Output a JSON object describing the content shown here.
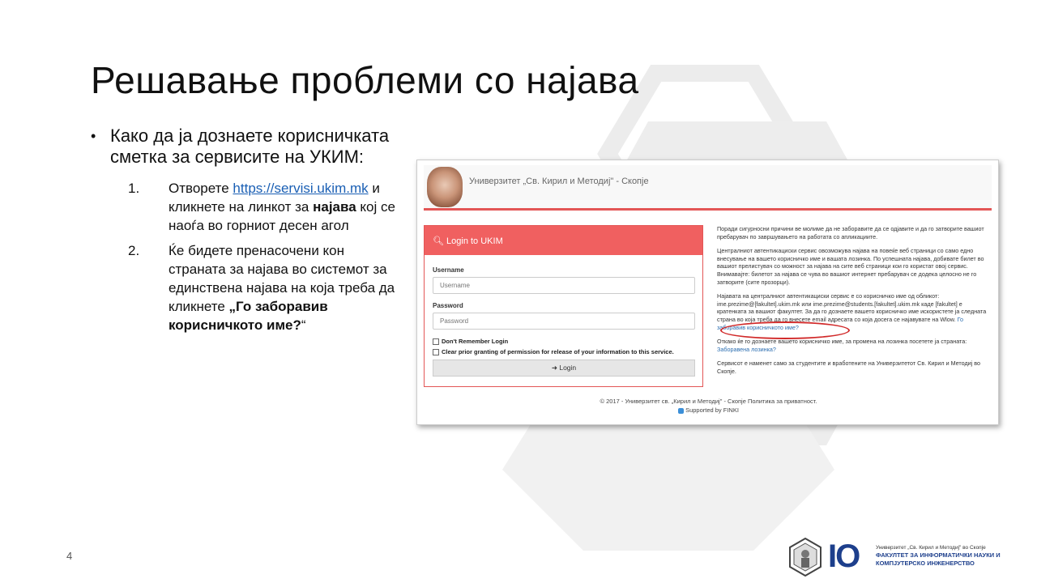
{
  "slide": {
    "title": "Решавање проблеми со најава",
    "page_number": "4"
  },
  "bullets": {
    "main": "Како да ја дознаете корисничката сметка за сервисите на УКИМ:",
    "steps": [
      {
        "num": "1.",
        "before": "Отворете ",
        "link": "https://servisi.ukim.mk",
        "middle": " и кликнете на линкот за ",
        "bold": "најава",
        "after": " кој се наоѓа во горниот десен агол"
      },
      {
        "num": "2.",
        "before": "Ќе бидете пренасочени кон страната за најава во системот за единствена најава на која треба да кликнете ",
        "bold": "„Го заборавив корисничкото име?",
        "after": "“"
      }
    ]
  },
  "screenshot": {
    "university": "Универзитет „Св. Кирил и Методиј\" - Скопје",
    "login": {
      "header": "Login to UKIM",
      "username_label": "Username",
      "username_placeholder": "Username",
      "password_label": "Password",
      "password_placeholder": "Password",
      "remember": "Don't Remember Login",
      "clear": "Clear prior granting of permission for release of your information to this service.",
      "button": "Login"
    },
    "info": {
      "p1": "Поради сигурносни причини ве молиме да не заборавите да се одјавите и да го затворите вашиот пребарувач по завршувањето на работата со апликациите.",
      "p2": "Централниот автентикациски сервис овозможува најава на повеќе веб страници со само едно внесување на вашето корисничко име и вашата лозинка. По успешната најава, добивате билет во вашиот прелистувач со можност за најава на сите веб страници кои го користат овој сервис. Внимавајте: билетот за најава се чува во вашиот интернет пребарувач се додека целосно не го затворите (сите прозорци).",
      "p3": "Најавата на централниот автентикациски сервис е со корисничко име од обликот: ime.prezime@[fakultet].ukim.mk или ime.prezime@students.[fakultet].ukim.mk каде [fakultet] е кратенката за вашиот факултет. За да го дознаете вашето корисничко име искористете ја следната страна во која треба да го внесете email адресата со која досега се најавувате на Wlow.",
      "link1": "Го заборавив корисничкото име?",
      "p4": "Откако ќе го дознаете вашето корисничко име, за промена на лозинка посетете ја страната:",
      "link2": "Заборавена лозинка?",
      "p5": "Сервисот е наменет само за студентите и вработените на Универзитетот Св. Кирил и Методиј во Скопје."
    },
    "footer": {
      "copyright": "© 2017 - Универзитет св. „Кирил и Методиј\" - Скопје Политика за приватност.",
      "supported": "Supported by FINKI"
    }
  },
  "footer_logo": {
    "io": "IO",
    "line1": "Универзитет „Св. Кирил и Методиј\" во Скопје",
    "line2": "ФАКУЛТЕТ ЗА ИНФОРМАТИЧКИ НАУКИ И",
    "line3": "КОМПЈУТЕРСКО ИНЖЕНЕРСТВО"
  },
  "colors": {
    "accent_red": "#f06060",
    "link_blue": "#1a5fb4",
    "logo_blue": "#1d3f8c"
  }
}
